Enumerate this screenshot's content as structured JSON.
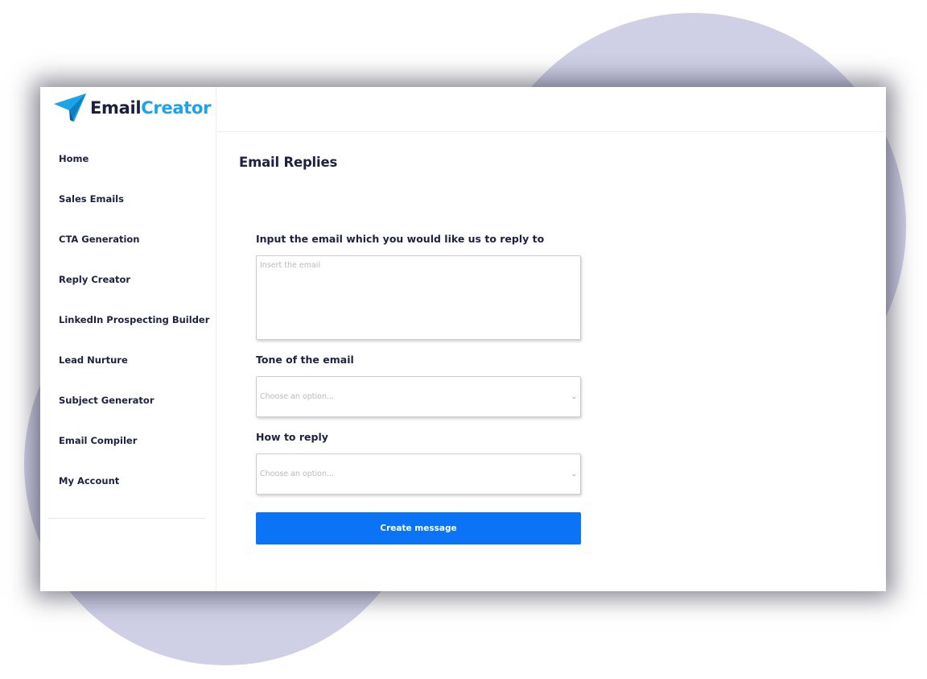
{
  "brand": {
    "part1": "Email",
    "part2": "Creator"
  },
  "sidebar": {
    "items": [
      {
        "label": "Home"
      },
      {
        "label": "Sales Emails"
      },
      {
        "label": "CTA Generation"
      },
      {
        "label": "Reply Creator"
      },
      {
        "label": "LinkedIn Prospecting Builder"
      },
      {
        "label": "Lead Nurture"
      },
      {
        "label": "Subject Generator"
      },
      {
        "label": "Email Compiler"
      },
      {
        "label": "My Account"
      }
    ]
  },
  "main": {
    "title": "Email Replies",
    "email_input": {
      "label": "Input the email which you would like us to reply to",
      "placeholder": "Insert the email",
      "value": ""
    },
    "tone": {
      "label": "Tone of the email",
      "selected": "Choose an option..."
    },
    "reply": {
      "label": "How to reply",
      "selected": "Choose an option..."
    },
    "submit_label": "Create message"
  },
  "colors": {
    "accent": "#0b73f5",
    "brand_dark": "#1a1f3d",
    "brand_light": "#1ca3ea",
    "blob": "#cfcfe6"
  },
  "icons": {
    "logo": "paper-plane-icon",
    "select": "chevron-down-icon"
  }
}
